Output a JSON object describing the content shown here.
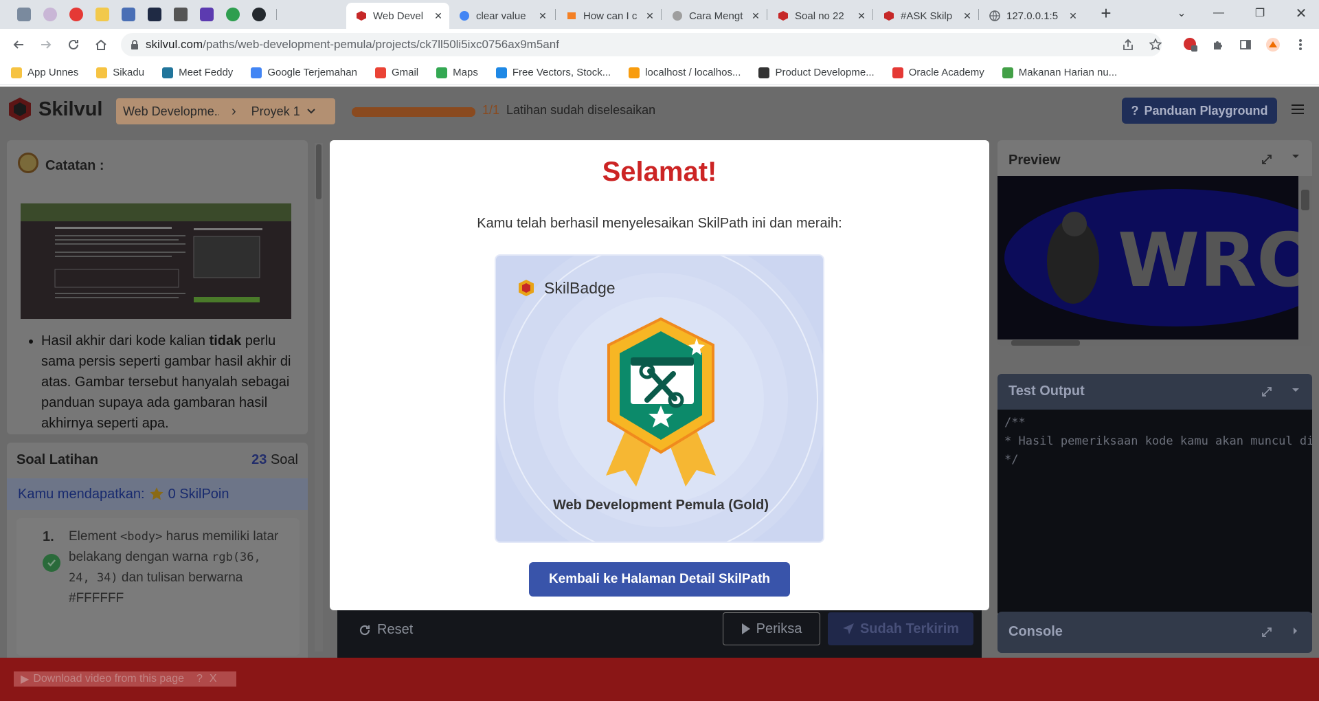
{
  "browser": {
    "tabs": [
      {
        "title": "Web Devel",
        "color": "#c62828",
        "active": true
      },
      {
        "title": "clear value",
        "color": "#4285f4"
      },
      {
        "title": "How can I c",
        "color": "#f48024"
      },
      {
        "title": "Cara Mengt",
        "color": "#9e9e9e"
      },
      {
        "title": "Soal no 22",
        "color": "#c62828"
      },
      {
        "title": "#ASK Skilp",
        "color": "#c62828"
      },
      {
        "title": "127.0.0.1:5",
        "color": "#5f6368"
      }
    ],
    "url_host": "skilvul.com",
    "url_path": "/paths/web-development-pemula/projects/ck7ll50li5ixc0756ax9m5anf",
    "bookmarks": [
      {
        "label": "App Unnes",
        "color": "#f6c342"
      },
      {
        "label": "Sikadu",
        "color": "#f6c342"
      },
      {
        "label": "Meet Feddy",
        "color": "#21759b"
      },
      {
        "label": "Google Terjemahan",
        "color": "#4285f4"
      },
      {
        "label": "Gmail",
        "color": "#ea4335"
      },
      {
        "label": "Maps",
        "color": "#34a853"
      },
      {
        "label": "Free Vectors, Stock...",
        "color": "#1e88e5"
      },
      {
        "label": "localhost / localhos...",
        "color": "#f89c0e"
      },
      {
        "label": "Product Developme...",
        "color": "#333333"
      },
      {
        "label": "Oracle Academy",
        "color": "#e53935"
      },
      {
        "label": "Makanan Harian nu...",
        "color": "#43a047"
      }
    ]
  },
  "app": {
    "logo": "Skilvul",
    "crumb_course": "Web Developme...",
    "crumb_project": "Proyek 1",
    "progress_count": "1/1",
    "progress_fraction": 1,
    "progress_text": "Latihan sudah diselesaikan",
    "guide_button": "Panduan Playground",
    "notes_title": "Catatan :",
    "notes_text_before": "Hasil akhir dari kode kalian ",
    "notes_text_bold": "tidak",
    "notes_text_after": " perlu sama persis seperti gambar hasil akhir di atas. Gambar tersebut hanyalah sebagai panduan supaya ada gambaran hasil akhirnya seperti apa.",
    "soal_title": "Soal Latihan",
    "soal_count": "23",
    "soal_unit": "Soal",
    "skilpoin_prefix": "Kamu mendapatkan:",
    "skilpoin_value": "0 SkilPoin",
    "question_number": "1.",
    "question_text_1": "Element ",
    "question_code_1": "<body>",
    "question_text_2": " harus memiliki latar belakang dengan warna ",
    "question_code_2": "rgb(36, 24, 34)",
    "question_text_3": " dan tulisan berwarna #FFFFFF",
    "preview_title": "Preview",
    "preview_logo_text": "WRO",
    "test_output_title": "Test Output",
    "test_output_lines": [
      "/**",
      "* Hasil pemeriksaan kode kamu akan muncul di",
      "*/"
    ],
    "console_title": "Console",
    "reset_label": "Reset",
    "periksa_label": "Periksa",
    "sent_label": "Sudah Terkirim"
  },
  "modal": {
    "title": "Selamat!",
    "subtitle": "Kamu telah berhasil menyelesaikan SkilPath ini dan meraih:",
    "badge_label": "SkilBadge",
    "badge_name": "Web Development Pemula (Gold)",
    "back_button": "Kembali ke Halaman Detail SkilPath"
  },
  "download_bar": {
    "label": "Download video from this page",
    "help": "?",
    "close": "X"
  },
  "colors": {
    "accent_red": "#cc2424",
    "button_blue": "#3954aa",
    "card_bg": "#ccd6f1"
  }
}
